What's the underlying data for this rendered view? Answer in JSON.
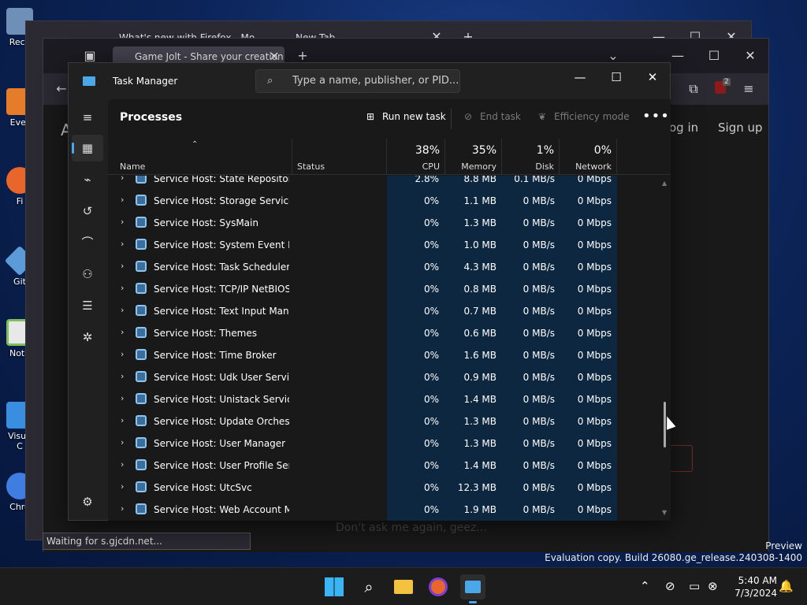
{
  "desktop": {
    "icons": [
      {
        "label": "Recy",
        "color": "#6d8fb8"
      },
      {
        "label": "Ever",
        "color": "#e57c2a"
      },
      {
        "label": "Fi",
        "color": "#e8652b"
      },
      {
        "label": "Git",
        "color": "#5a9bd8"
      },
      {
        "label": "Note",
        "color": "#7fbf5a"
      },
      {
        "label": "Visua",
        "color": "#3a8ee0"
      },
      {
        "label": "C",
        "color": "#3a8ee0"
      },
      {
        "label": "Chro",
        "color": "#3f7ee0"
      }
    ]
  },
  "browser_back": {
    "tab1": "What's new with Firefox - Mo",
    "tab2": "New Tab"
  },
  "browser_front": {
    "tab_active": "Game Jolt - Share your creation",
    "login": "og in",
    "signup": "Sign up",
    "badge": "2",
    "status_text": "Waiting for s.gjcdn.net...",
    "dont_ask": "Don't ask me again, geez..."
  },
  "watermark": {
    "line1": "Preview",
    "line2": "Evaluation copy. Build 26080.ge_release.240308-1400"
  },
  "task_manager": {
    "title": "Task Manager",
    "search_placeholder": "Type a name, publisher, or PID...",
    "page_title": "Processes",
    "commands": {
      "run_new_task": "Run new task",
      "end_task": "End task",
      "efficiency_mode": "Efficiency mode"
    },
    "columns": {
      "name": "Name",
      "status": "Status",
      "cpu_pct": "38%",
      "cpu": "CPU",
      "memory_pct": "35%",
      "memory": "Memory",
      "disk_pct": "1%",
      "disk": "Disk",
      "network_pct": "0%",
      "network": "Network"
    },
    "rows": [
      {
        "name": "Service Host: State Repository ...",
        "cpu": "2.8%",
        "mem": "8.8 MB",
        "disk": "0.1 MB/s",
        "net": "0 Mbps"
      },
      {
        "name": "Service Host: Storage Service",
        "cpu": "0%",
        "mem": "1.1 MB",
        "disk": "0 MB/s",
        "net": "0 Mbps"
      },
      {
        "name": "Service Host: SysMain",
        "cpu": "0%",
        "mem": "1.3 MB",
        "disk": "0 MB/s",
        "net": "0 Mbps"
      },
      {
        "name": "Service Host: System Event No...",
        "cpu": "0%",
        "mem": "1.0 MB",
        "disk": "0 MB/s",
        "net": "0 Mbps"
      },
      {
        "name": "Service Host: Task Scheduler",
        "cpu": "0%",
        "mem": "4.3 MB",
        "disk": "0 MB/s",
        "net": "0 Mbps"
      },
      {
        "name": "Service Host: TCP/IP NetBIOS ...",
        "cpu": "0%",
        "mem": "0.8 MB",
        "disk": "0 MB/s",
        "net": "0 Mbps"
      },
      {
        "name": "Service Host: Text Input Mana...",
        "cpu": "0%",
        "mem": "0.7 MB",
        "disk": "0 MB/s",
        "net": "0 Mbps"
      },
      {
        "name": "Service Host: Themes",
        "cpu": "0%",
        "mem": "0.6 MB",
        "disk": "0 MB/s",
        "net": "0 Mbps"
      },
      {
        "name": "Service Host: Time Broker",
        "cpu": "0%",
        "mem": "1.6 MB",
        "disk": "0 MB/s",
        "net": "0 Mbps"
      },
      {
        "name": "Service Host: Udk User Service...",
        "cpu": "0%",
        "mem": "0.9 MB",
        "disk": "0 MB/s",
        "net": "0 Mbps"
      },
      {
        "name": "Service Host: Unistack Service ...",
        "cpu": "0%",
        "mem": "1.4 MB",
        "disk": "0 MB/s",
        "net": "0 Mbps"
      },
      {
        "name": "Service Host: Update Orchestr...",
        "cpu": "0%",
        "mem": "1.3 MB",
        "disk": "0 MB/s",
        "net": "0 Mbps"
      },
      {
        "name": "Service Host: User Manager",
        "cpu": "0%",
        "mem": "1.3 MB",
        "disk": "0 MB/s",
        "net": "0 Mbps"
      },
      {
        "name": "Service Host: User Profile Servi...",
        "cpu": "0%",
        "mem": "1.4 MB",
        "disk": "0 MB/s",
        "net": "0 Mbps"
      },
      {
        "name": "Service Host: UtcSvc",
        "cpu": "0%",
        "mem": "12.3 MB",
        "disk": "0 MB/s",
        "net": "0 Mbps"
      },
      {
        "name": "Service Host: Web Account M...",
        "cpu": "0%",
        "mem": "1.9 MB",
        "disk": "0 MB/s",
        "net": "0 Mbps"
      }
    ]
  },
  "taskbar": {
    "time": "5:40 AM",
    "date": "7/3/2024"
  },
  "colors": {
    "accent": "#4aa8e8",
    "heat": "#0e2740"
  }
}
